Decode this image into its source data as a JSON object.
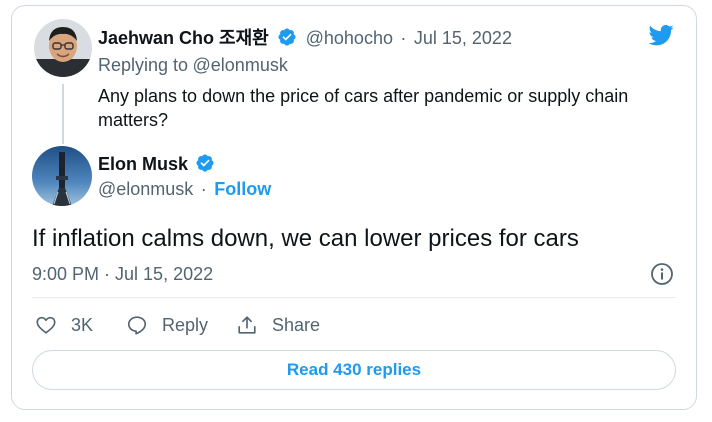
{
  "reply_tweet": {
    "author_name": "Jaehwan Cho 조재환",
    "handle": "@hohocho",
    "separator": "·",
    "date": "Jul 15, 2022",
    "replying_to_label": "Replying to",
    "replying_to_handle": "@elonmusk",
    "text": "Any plans to down the price of cars after pandemic or supply chain matters?"
  },
  "main_tweet": {
    "author_name": "Elon Musk",
    "handle": "@elonmusk",
    "separator": "·",
    "follow_label": "Follow",
    "text": "If inflation calms down, we can lower prices for cars",
    "timestamp": "9:00 PM · Jul 15, 2022"
  },
  "actions": {
    "like_count": "3K",
    "reply_label": "Reply",
    "share_label": "Share"
  },
  "read_replies_label": "Read 430 replies",
  "colors": {
    "accent": "#1d9bf0",
    "text": "#0f1419",
    "muted": "#536471",
    "border": "#cfd9de"
  },
  "icons": [
    "verified-badge-icon",
    "twitter-bird-icon",
    "info-icon",
    "heart-icon",
    "reply-bubble-icon",
    "share-icon"
  ]
}
